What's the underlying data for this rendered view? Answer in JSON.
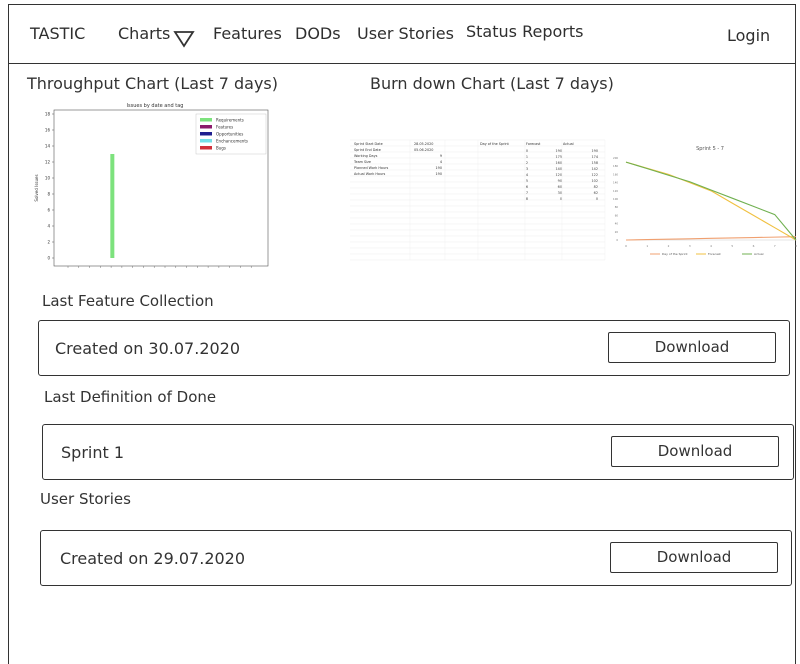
{
  "nav": {
    "brand": "TASTIC",
    "charts": "Charts",
    "features": "Features",
    "dods": "DODs",
    "user_stories": "User Stories",
    "status_reports": "Status Reports",
    "login": "Login"
  },
  "throughput": {
    "title": "Throughput Chart (Last 7 days)",
    "chart_data": {
      "type": "bar",
      "title": "Issues by date and tag",
      "ylabel": "Solved Issues",
      "ylim": [
        0,
        18
      ],
      "yticks": [
        0,
        2,
        4,
        6,
        8,
        10,
        12,
        14,
        16,
        18
      ],
      "series": [
        {
          "name": "Requirements",
          "color": "#7de27d"
        },
        {
          "name": "Features",
          "color": "#8b1a6b"
        },
        {
          "name": "Opportunities",
          "color": "#1f1f8f"
        },
        {
          "name": "Enchancements",
          "color": "#74e0e8"
        },
        {
          "name": "Bugs",
          "color": "#d0303a"
        }
      ],
      "bars": [
        {
          "series": "Requirements",
          "position": 3,
          "value": 13
        }
      ]
    }
  },
  "burndown": {
    "title": "Burn down Chart (Last 7 days)",
    "info_rows": [
      [
        "Sprint Start Date",
        "28.05.2020"
      ],
      [
        "Sprint End Date",
        "05.06.2020"
      ],
      [
        "Working Days",
        "9"
      ],
      [
        "Team Size",
        "4"
      ],
      [
        "Planned Work Hours",
        "190"
      ],
      [
        "Actual Work Hours",
        "190"
      ]
    ],
    "table_headers": [
      "Day of the Sprint",
      "Forecast",
      "Actual"
    ],
    "table_rows": [
      [
        "0",
        "190",
        "190"
      ],
      [
        "1",
        "175",
        "174"
      ],
      [
        "2",
        "160",
        "158"
      ],
      [
        "3",
        "140",
        "142"
      ],
      [
        "4",
        "120",
        "122"
      ],
      [
        "5",
        "90",
        "102"
      ],
      [
        "6",
        "60",
        "82"
      ],
      [
        "7",
        "30",
        "62"
      ],
      [
        "8",
        "0",
        "0"
      ]
    ],
    "chart_data": {
      "type": "line",
      "title": "Sprint 5 - 7",
      "x": [
        0,
        1,
        2,
        3,
        4,
        5,
        6,
        7,
        8
      ],
      "ylim": [
        0,
        200
      ],
      "series": [
        {
          "name": "Day of the Sprint",
          "color": "#f0a070",
          "values": [
            0,
            1,
            2,
            3,
            4,
            5,
            6,
            7,
            8
          ]
        },
        {
          "name": "Forecast",
          "color": "#f0c040",
          "values": [
            190,
            175,
            160,
            140,
            120,
            90,
            60,
            30,
            0
          ]
        },
        {
          "name": "Actual",
          "color": "#70b050",
          "values": [
            190,
            174,
            158,
            142,
            122,
            102,
            82,
            62,
            0
          ]
        }
      ]
    }
  },
  "sections": {
    "feature_collection": {
      "title": "Last Feature Collection",
      "text": "Created on 30.07.2020",
      "button": "Download"
    },
    "definition_of_done": {
      "title": "Last Definition of Done",
      "text": "Sprint 1",
      "button": "Download"
    },
    "user_stories": {
      "title": "User Stories",
      "text": "Created on 29.07.2020",
      "button": "Download"
    }
  }
}
